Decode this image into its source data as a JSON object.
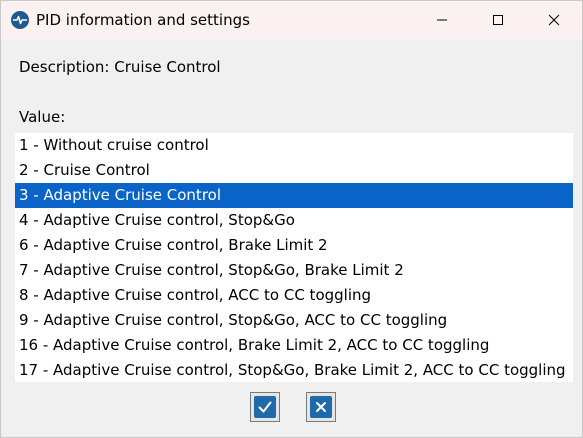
{
  "window": {
    "title": "PID information and settings",
    "icon": "heartbeat-icon"
  },
  "title_buttons": {
    "minimize": "minimize-icon",
    "maximize": "maximize-icon",
    "close": "close-icon"
  },
  "description": {
    "text": "Description: Cruise Control"
  },
  "value": {
    "label": "Value:",
    "selected_index": 2,
    "items": [
      "1 - Without cruise control",
      "2 - Cruise Control",
      "3 - Adaptive Cruise Control",
      "4 - Adaptive Cruise control, Stop&Go",
      "6 - Adaptive Cruise control, Brake Limit 2",
      "7 - Adaptive Cruise control, Stop&Go, Brake Limit 2",
      "8 - Adaptive Cruise control, ACC to CC toggling",
      "9 - Adaptive Cruise control, Stop&Go, ACC to CC toggling",
      "16 - Adaptive Cruise control, Brake Limit 2, ACC to CC toggling",
      "17 - Adaptive Cruise control, Stop&Go, Brake Limit 2, ACC to CC toggling"
    ]
  },
  "buttons": {
    "ok_icon": "check-icon",
    "cancel_icon": "x-icon"
  },
  "colors": {
    "selection": "#0a64c8",
    "titlebar": "#fbf1f1",
    "button_accent": "#1f6aa8"
  }
}
